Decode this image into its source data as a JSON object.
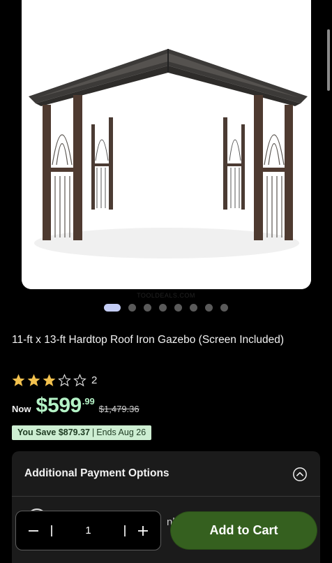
{
  "product": {
    "title": "11-ft x 13-ft Hardtop Roof Iron Gazebo (Screen Included)",
    "image_alt": "Gazebo product photo",
    "watermark": "TOOLDEALS.COM"
  },
  "carousel": {
    "total": 8,
    "active_index": 0
  },
  "rating": {
    "stars": 3,
    "max_stars": 5,
    "count": "2"
  },
  "pricing": {
    "now_label": "Now",
    "currency": "$",
    "dollars": "599",
    "cents": ".99",
    "was_price": "$1,479.36",
    "save_amount": "You Save $879.37",
    "separator": "|",
    "ends": "Ends Aug 26"
  },
  "payment_panel": {
    "title": "Additional Payment Options",
    "partial_option_text": "nly"
  },
  "cart_bar": {
    "quantity": "1",
    "add_to_cart_label": "Add to Cart"
  },
  "colors": {
    "price_green": "#b4f2c6",
    "badge_bg": "#cdeed2",
    "cart_button": "#35601f",
    "star_fill": "#f2c14e"
  }
}
